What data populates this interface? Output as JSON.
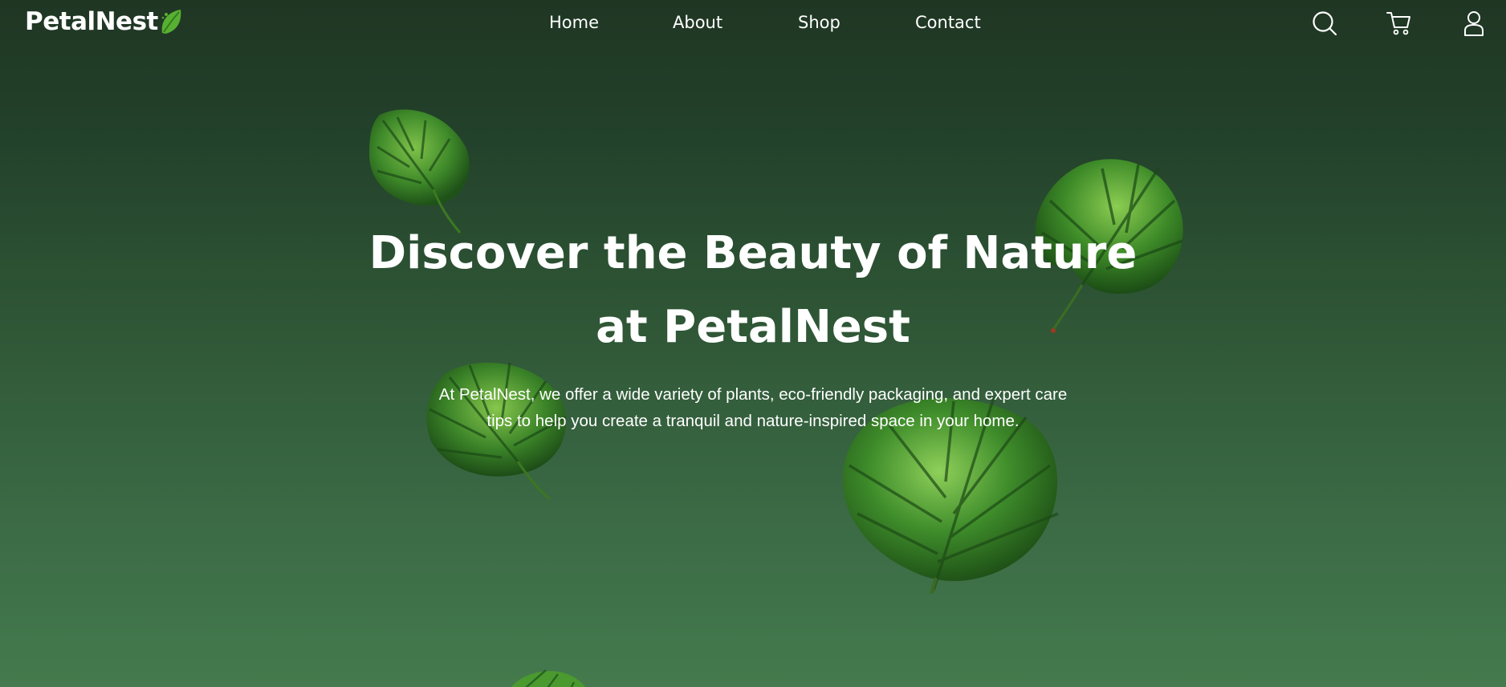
{
  "brand": {
    "name": "PetalNest",
    "leaf_icon": "leaf-icon"
  },
  "nav": {
    "links": [
      {
        "label": "Home"
      },
      {
        "label": "About"
      },
      {
        "label": "Shop"
      },
      {
        "label": "Contact"
      }
    ],
    "icons": [
      "search-icon",
      "cart-icon",
      "user-icon"
    ]
  },
  "hero": {
    "title_line1": "Discover the Beauty of Nature",
    "title_line2": "at PetalNest",
    "subtitle": "At PetalNest, we offer a wide variety of plants, eco-friendly packaging, and expert care tips to help you create a tranquil and nature-inspired space in your home."
  },
  "colors": {
    "background_top": "#1f3623",
    "background_bottom": "#447a4d",
    "text": "#ffffff",
    "leaf_accent": "#6fbf3f"
  }
}
